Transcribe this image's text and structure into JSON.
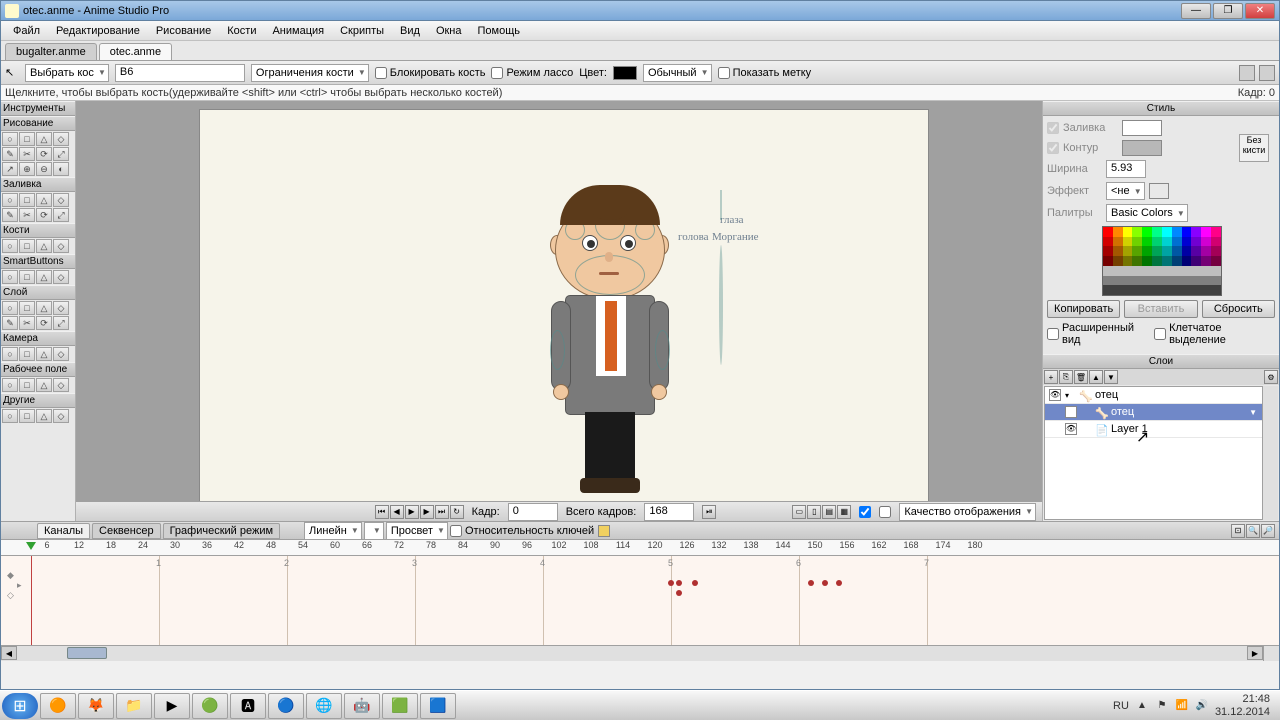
{
  "titlebar": {
    "text": "otec.anme - Anime Studio Pro"
  },
  "menubar": [
    "Файл",
    "Редактирование",
    "Рисование",
    "Кости",
    "Анимация",
    "Скрипты",
    "Вид",
    "Окна",
    "Помощь"
  ],
  "filetabs": [
    {
      "label": "bugalter.anme",
      "active": false
    },
    {
      "label": "otec.anme",
      "active": true
    }
  ],
  "optbar": {
    "mode": "Выбрать кос",
    "bone_name": "B6",
    "constraint": "Ограничения кости",
    "lock_label": "Блокировать кость",
    "lasso_label": "Режим лассо",
    "color_label": "Цвет:",
    "color_mode": "Обычный",
    "show_label": "Показать метку"
  },
  "hint": {
    "left": "Щелкните, чтобы выбрать кость(удерживайте <shift> или <ctrl> чтобы выбрать несколько костей)",
    "right": "Кадр: 0"
  },
  "tools": {
    "header": "Инструменты",
    "groups": [
      {
        "name": "Рисование",
        "rows": 3
      },
      {
        "name": "Заливка",
        "rows": 2
      },
      {
        "name": "Кости",
        "rows": 1
      },
      {
        "name": "SmartButtons",
        "rows": 1
      },
      {
        "name": "Слой",
        "rows": 2
      },
      {
        "name": "Камера",
        "rows": 1
      },
      {
        "name": "Рабочее поле",
        "rows": 1
      },
      {
        "name": "Другие",
        "rows": 1
      }
    ]
  },
  "canvas": {
    "labels": {
      "eyes": "глаза",
      "head": "голова",
      "blink": "Моргание"
    },
    "bottombar": {
      "frame_label": "Кадр:",
      "frame": "0",
      "total_label": "Всего кадров:",
      "total": "168",
      "quality": "Качество отображения"
    }
  },
  "style": {
    "header": "Стиль",
    "fill_label": "Заливка",
    "outline_label": "Контур",
    "width_label": "Ширина",
    "width": "5.93",
    "nobrush": "Без кисти",
    "effect_label": "Эффект",
    "effect": "<не",
    "palettes_label": "Палитры",
    "palette_name": "Basic Colors",
    "copy": "Копировать",
    "paste": "Вставить",
    "reset": "Сбросить",
    "advanced": "Расширенный вид",
    "checker": "Клетчатое выделение"
  },
  "layers": {
    "header": "Слои",
    "items": [
      {
        "name": "отец",
        "kind": "bone",
        "depth": 0,
        "expanded": true,
        "selected": false
      },
      {
        "name": "отец",
        "kind": "bone",
        "depth": 1,
        "selected": true
      },
      {
        "name": "Layer 1",
        "kind": "vector",
        "depth": 1,
        "selected": false
      }
    ]
  },
  "timeline": {
    "tabs": [
      "Каналы",
      "Секвенсер",
      "Графический режим"
    ],
    "interp": "Линейн",
    "onion": "Просвет",
    "relkeys": "Относительность ключей",
    "frames": [
      "6",
      "12",
      "18",
      "24",
      "30",
      "36",
      "42",
      "48",
      "54",
      "60",
      "66",
      "72",
      "78",
      "84",
      "90",
      "96",
      "102",
      "108",
      "114",
      "120",
      "126",
      "132",
      "138",
      "144",
      "150",
      "156",
      "162",
      "168",
      "174",
      "180"
    ],
    "seconds": [
      "1",
      "2",
      "3",
      "4",
      "5",
      "6",
      "7"
    ],
    "keys": [
      [
        670,
        24
      ],
      [
        678,
        24
      ],
      [
        694,
        24
      ],
      [
        810,
        24
      ],
      [
        824,
        24
      ],
      [
        838,
        24
      ],
      [
        678,
        34
      ]
    ]
  },
  "taskbar": {
    "icons": [
      "🟠",
      "🦊",
      "📁",
      "▶",
      "🟢",
      "🅰",
      "🔵",
      "🌐",
      "🤖",
      "🟩",
      "🟦"
    ],
    "tray": {
      "lang": "RU",
      "time": "21:48",
      "date": "31.12.2014"
    }
  }
}
